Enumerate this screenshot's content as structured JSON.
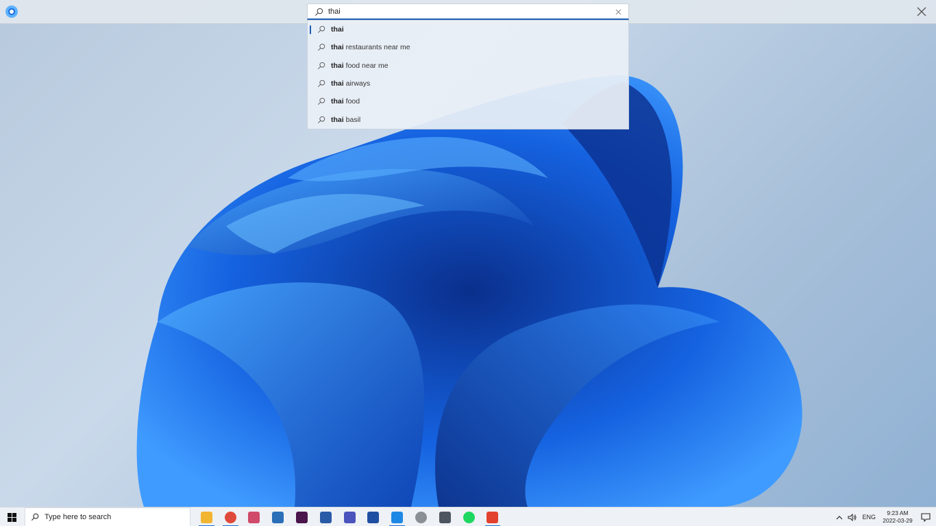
{
  "search": {
    "query": "thai",
    "placeholder": ""
  },
  "suggestions": [
    {
      "bold": "thai",
      "rest": ""
    },
    {
      "bold": "thai",
      "rest": "restaurants near me"
    },
    {
      "bold": "thai",
      "rest": "food near me"
    },
    {
      "bold": "thai",
      "rest": "airways"
    },
    {
      "bold": "thai",
      "rest": "food"
    },
    {
      "bold": "thai",
      "rest": "basil"
    }
  ],
  "taskbar": {
    "search_placeholder": "Type here to search",
    "apps": [
      {
        "name": "file-explorer",
        "color": "#f2b531",
        "running": true
      },
      {
        "name": "chrome",
        "color": "#e04a3a",
        "running": true
      },
      {
        "name": "paint",
        "color": "#d04a6a",
        "running": false
      },
      {
        "name": "remote-desktop",
        "color": "#2a6fb8",
        "running": false
      },
      {
        "name": "slack",
        "color": "#4a154b",
        "running": false
      },
      {
        "name": "powershell",
        "color": "#2b5aa7",
        "running": false
      },
      {
        "name": "teams",
        "color": "#4b53bc",
        "running": false
      },
      {
        "name": "remote-connection",
        "color": "#1f4fa0",
        "running": false
      },
      {
        "name": "vscode",
        "color": "#1e88e5",
        "running": true
      },
      {
        "name": "clock",
        "color": "#8a8f96",
        "running": false
      },
      {
        "name": "calculator",
        "color": "#4d5560",
        "running": false
      },
      {
        "name": "spotify",
        "color": "#1ed760",
        "running": false
      },
      {
        "name": "screen-recorder",
        "color": "#e3412f",
        "running": true
      }
    ],
    "tray": {
      "language": "ENG",
      "time": "9:23 AM",
      "date": "2022-03-29"
    }
  },
  "colors": {
    "accent": "#1a5fb4",
    "taskbar_bg": "#eef1f5"
  }
}
